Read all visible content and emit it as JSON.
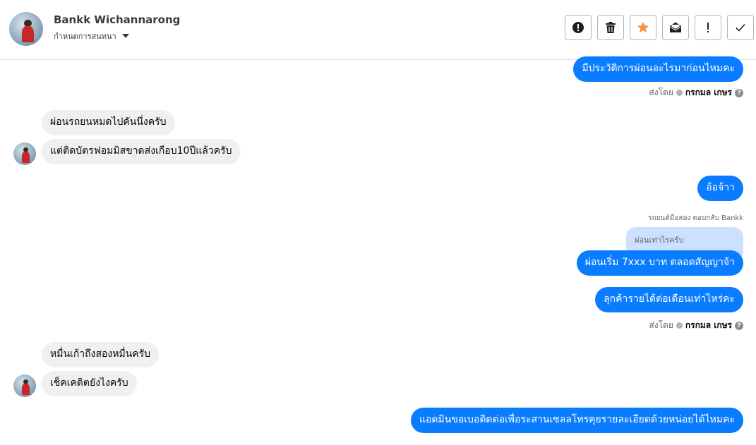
{
  "header": {
    "name": "Bankk Wichannarong",
    "subtitle": "กำหนดการสนทนา"
  },
  "toolbar": {
    "buttons": [
      {
        "icon": "alert-icon"
      },
      {
        "icon": "trash-icon"
      },
      {
        "icon": "star-icon",
        "color": "#f7923a"
      },
      {
        "icon": "mail-icon"
      },
      {
        "icon": "exclamation-icon"
      },
      {
        "icon": "check-icon"
      }
    ]
  },
  "colors": {
    "outgoing": "#0a7cff",
    "incoming": "#f0f0f0",
    "quoted": "#cce0ff"
  },
  "messages": {
    "m1": "มีประวัติการผ่อนอะไรมาก่อนไหมคะ",
    "m2": "ผ่อนรถยนหมดไปคันนึ่งครับ",
    "m3": "แต่ติดบัตรฟอมมิสขาดส่งเกือบ10ปีแล้วครับ",
    "m4": "อ้อจ้าา",
    "m5": "ผ่อนเริ่ม 7xxx บาท ตลอดสัญญาจ้า",
    "m6": "ลุกค้ารายได้ต่อเดือนเท่าไหร่คะ",
    "m7": "หมื่นเก้าถึงสองหมื่นครับ",
    "m8": "เช็คเคดิตยังไงครับ",
    "m9": "แอดมินขอเบอติดต่อเพื่อระสานเซลลโทรคุยรายละเอียดด้วยหน่อยได้ไหมคะ"
  },
  "meta": {
    "sent_by_label": "ส่งโดย",
    "sender": "กรกมล เกษร",
    "help": "?"
  },
  "reply": {
    "meta": "รถยนต์มือสอง ตอบกลับ Bankk",
    "quoted": "ผ่อนเท่าไรครับ"
  }
}
